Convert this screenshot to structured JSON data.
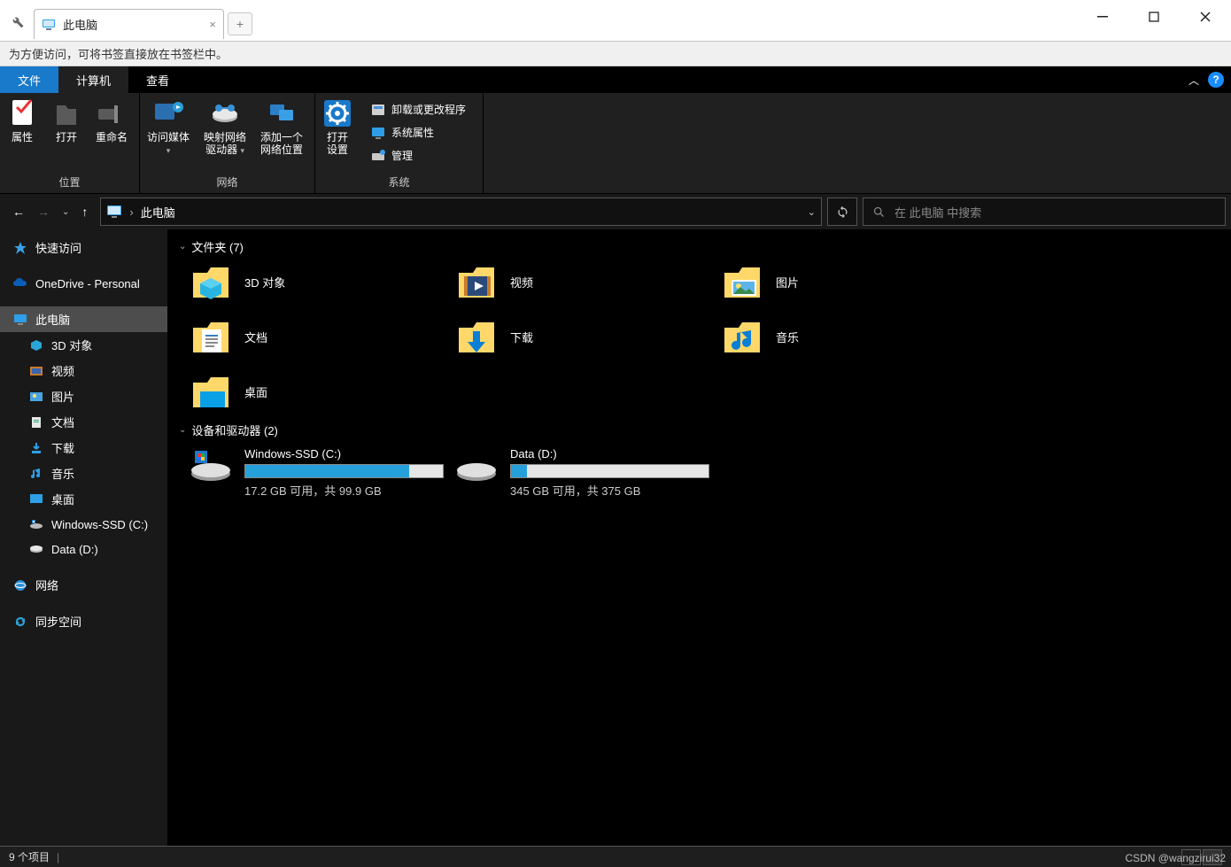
{
  "chrome": {
    "tab_title": "此电脑",
    "bookmark_hint": "为方便访问，可将书签直接放在书签栏中。"
  },
  "ribbon": {
    "tabs": {
      "file": "文件",
      "computer": "计算机",
      "view": "查看"
    },
    "groups": {
      "location": {
        "label": "位置",
        "buttons": {
          "properties": "属性",
          "open": "打开",
          "rename": "重命名"
        }
      },
      "network": {
        "label": "网络",
        "buttons": {
          "media": "访问媒体",
          "map_drive_l1": "映射网络",
          "map_drive_l2": "驱动器",
          "add_loc_l1": "添加一个",
          "add_loc_l2": "网络位置"
        }
      },
      "system": {
        "label": "系统",
        "open_settings_l1": "打开",
        "open_settings_l2": "设置",
        "uninstall": "卸载或更改程序",
        "sys_props": "系统属性",
        "manage": "管理"
      }
    }
  },
  "address": {
    "location": "此电脑",
    "search_placeholder": "在 此电脑 中搜索"
  },
  "nav": {
    "quick_access": "快速访问",
    "onedrive": "OneDrive - Personal",
    "this_pc": "此电脑",
    "children": {
      "objects3d": "3D 对象",
      "videos": "视频",
      "pictures": "图片",
      "documents": "文档",
      "downloads": "下载",
      "music": "音乐",
      "desktop": "桌面",
      "drive_c": "Windows-SSD (C:)",
      "drive_d": "Data (D:)"
    },
    "network": "网络",
    "sync": "同步空间"
  },
  "content": {
    "folders_header": "文件夹 (7)",
    "devices_header": "设备和驱动器 (2)",
    "folders": {
      "objects3d": "3D 对象",
      "videos": "视频",
      "pictures": "图片",
      "documents": "文档",
      "downloads": "下载",
      "music": "音乐",
      "desktop": "桌面"
    },
    "drives": {
      "c": {
        "name": "Windows-SSD (C:)",
        "subtitle": "17.2 GB 可用，共 99.9 GB",
        "used_pct": 83
      },
      "d": {
        "name": "Data (D:)",
        "subtitle": "345 GB 可用，共 375 GB",
        "used_pct": 8
      }
    }
  },
  "status": {
    "items": "9 个项目"
  },
  "watermark": "CSDN @wangzirui32"
}
